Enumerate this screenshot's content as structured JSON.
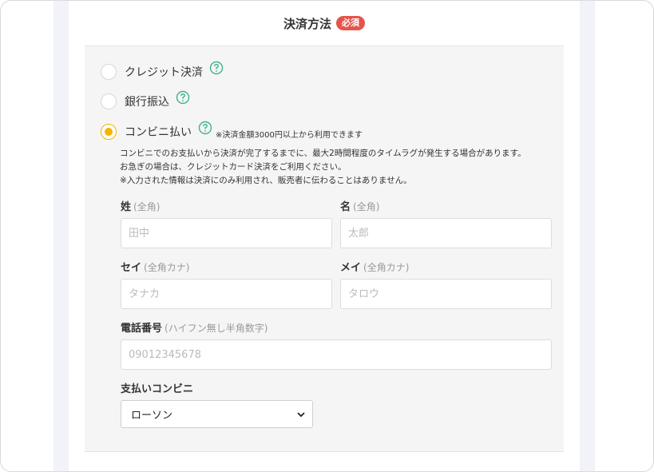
{
  "section": {
    "title": "決済方法",
    "required_badge": "必須"
  },
  "payment_options": [
    {
      "label": "クレジット決済",
      "selected": false
    },
    {
      "label": "銀行振込",
      "selected": false
    },
    {
      "label": "コンビニ払い",
      "selected": true,
      "notice": "※決済金額3000円以上から利用できます"
    }
  ],
  "description": [
    "コンビニでのお支払いから決済が完了するまでに、最大2時間程度のタイムラグが発生する場合があります。",
    "お急ぎの場合は、クレジットカード決済をご利用ください。",
    "※入力された情報は決済にのみ利用され、販売者に伝わることはありません。"
  ],
  "form": {
    "last_name": {
      "label": "姓",
      "hint": "(全角)",
      "placeholder": "田中",
      "value": ""
    },
    "first_name": {
      "label": "名",
      "hint": "(全角)",
      "placeholder": "太郎",
      "value": ""
    },
    "last_name_kana": {
      "label": "セイ",
      "hint": "(全角カナ)",
      "placeholder": "タナカ",
      "value": ""
    },
    "first_name_kana": {
      "label": "メイ",
      "hint": "(全角カナ)",
      "placeholder": "タロウ",
      "value": ""
    },
    "phone": {
      "label": "電話番号",
      "hint": "(ハイフン無し半角数字)",
      "placeholder": "09012345678",
      "value": ""
    },
    "store": {
      "label": "支払いコンビニ",
      "selected": "ローソン"
    }
  },
  "colors": {
    "accent_radio": "#f4b400",
    "required_badge": "#e5544b",
    "help_icon": "#3cb38a"
  },
  "icons": {
    "help": "question-circle-icon",
    "select": "chevron-down-icon"
  }
}
